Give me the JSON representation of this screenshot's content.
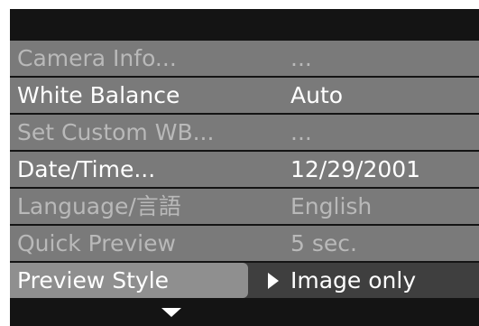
{
  "menu": {
    "items": [
      {
        "label": "Camera Info...",
        "value": "...",
        "state": "dim"
      },
      {
        "label": "White Balance",
        "value": "Auto",
        "state": "bright"
      },
      {
        "label": "Set Custom WB...",
        "value": "...",
        "state": "dim"
      },
      {
        "label": "Date/Time...",
        "value": "12/29/2001",
        "state": "bright"
      },
      {
        "label": "Language/言語",
        "value": "English",
        "state": "dim"
      },
      {
        "label": "Quick Preview",
        "value": "5 sec.",
        "state": "dim"
      },
      {
        "label": "Preview Style",
        "value": "Image only",
        "state": "selected"
      }
    ]
  },
  "icons": {
    "selection_indicator": "right-triangle-icon",
    "scroll_down": "down-triangle-icon"
  },
  "colors": {
    "screen_bg": "#141414",
    "row_bg": "#7a7a7a",
    "selected_label_bg": "#8f8f8f",
    "dim_text": "#b9b9b9",
    "bright_text": "#ffffff"
  }
}
